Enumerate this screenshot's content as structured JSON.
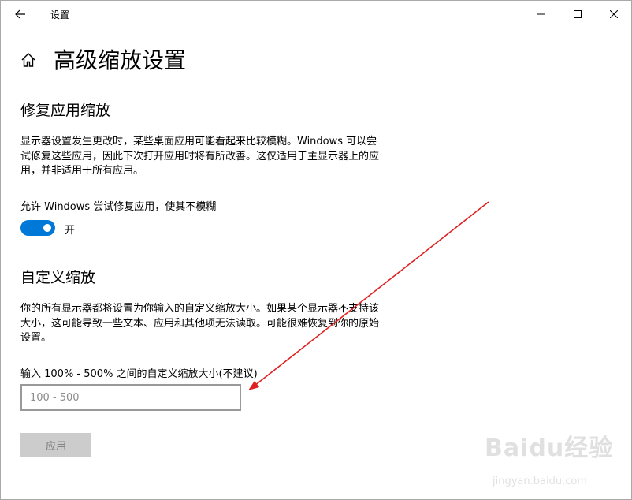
{
  "window": {
    "title": "设置",
    "controls": [
      "minimize-icon",
      "maximize-icon",
      "close-icon"
    ]
  },
  "header": {
    "home_icon": "home-icon",
    "title": "高级缩放设置"
  },
  "fix_section": {
    "heading": "修复应用缩放",
    "description": "显示器设置发生更改时，某些桌面应用可能看起来比较模糊。Windows 可以尝试修复这些应用，因此下次打开应用时将有所改善。这仅适用于主显示器上的应用，并非适用于所有应用。",
    "toggle_label": "允许 Windows 尝试修复应用，使其不模糊",
    "toggle_state": "开",
    "toggle_on": true
  },
  "custom_section": {
    "heading": "自定义缩放",
    "description": "你的所有显示器都将设置为你输入的自定义缩放大小。如果某个显示器不支持该大小，这可能导致一些文本、应用和其他项无法读取。可能很难恢复到你的原始设置。",
    "input_label": "输入 100% - 500% 之间的自定义缩放大小(不建议)",
    "input_value": "",
    "input_placeholder": "100 - 500",
    "apply_label": "应用"
  },
  "colors": {
    "accent": "#0078d7",
    "annotation_arrow": "#e02020",
    "button_disabled_bg": "#cccccc"
  },
  "watermark": {
    "logo": "Baidu经验",
    "url": "jingyan.baidu.com"
  }
}
